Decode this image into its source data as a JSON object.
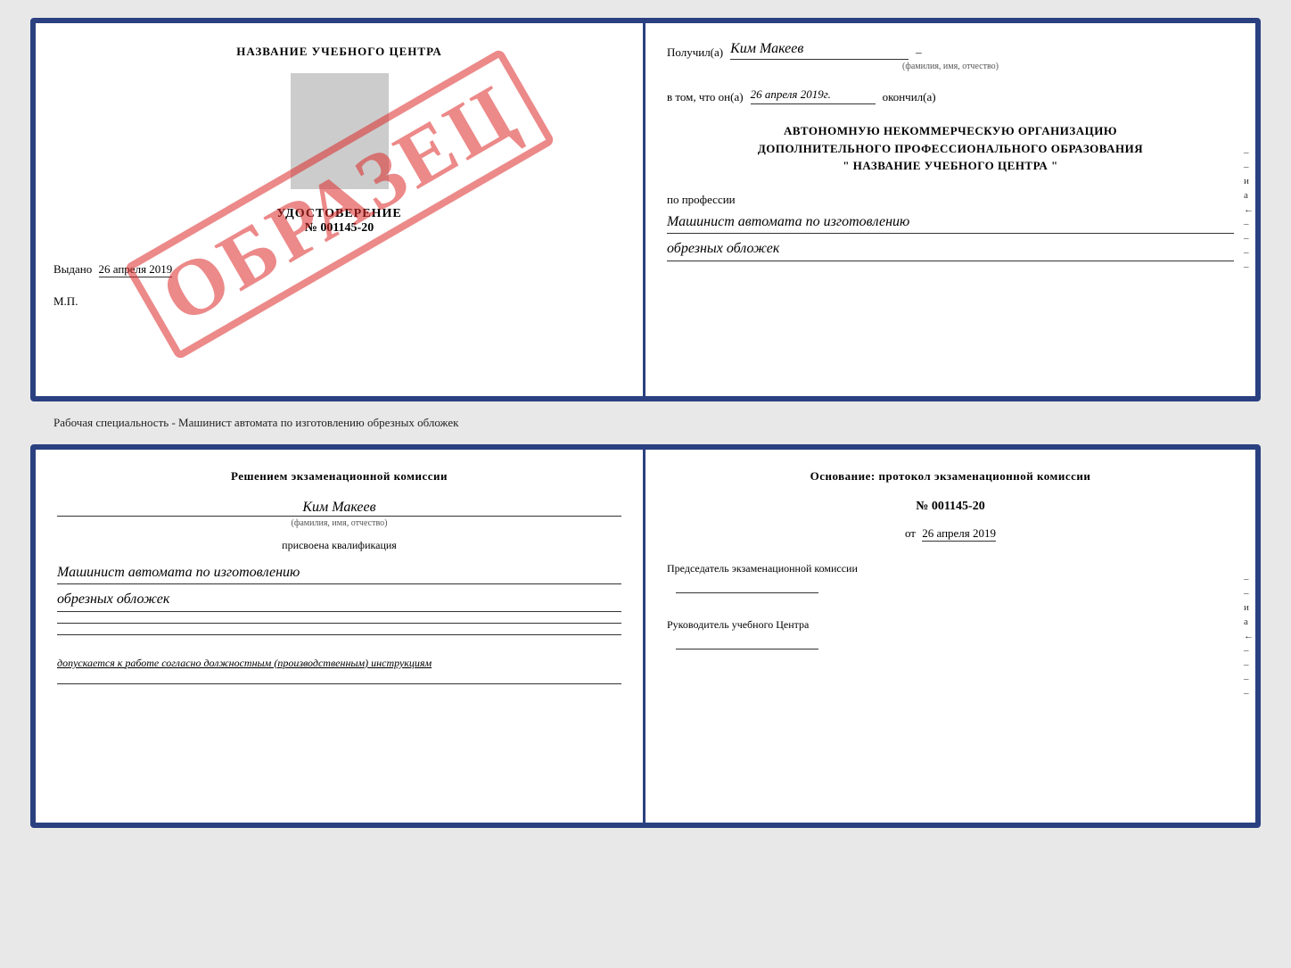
{
  "doc1": {
    "left": {
      "title": "НАЗВАНИЕ УЧЕБНОГО ЦЕНТРА",
      "watermark": "ОБРАЗЕЦ",
      "cert_label": "УДОСТОВЕРЕНИЕ",
      "cert_number": "№ 001145-20",
      "vydano_label": "Выдано",
      "vydano_date": "26 апреля 2019",
      "mp_label": "М.П."
    },
    "right": {
      "poluchil_label": "Получил(а)",
      "poluchil_name": "Ким Макеев",
      "fio_hint": "(фамилия, имя, отчество)",
      "vtom_label": "в том, что он(а)",
      "vtom_date": "26 апреля 2019г.",
      "okonchil_label": "окончил(а)",
      "org_line1": "АВТОНОМНУЮ НЕКОММЕРЧЕСКУЮ ОРГАНИЗАЦИЮ",
      "org_line2": "ДОПОЛНИТЕЛЬНОГО ПРОФЕССИОНАЛЬНОГО ОБРАЗОВАНИЯ",
      "org_line3": "\"  НАЗВАНИЕ УЧЕБНОГО ЦЕНТРА  \"",
      "po_professii_label": "по профессии",
      "professiya_line1": "Машинист автомата по изготовлению",
      "professiya_line2": "обрезных обложек"
    }
  },
  "specialty_label": "Рабочая специальность - Машинист автомата по изготовлению обрезных обложек",
  "doc2": {
    "left": {
      "resheniem_label": "Решением экзаменационной комиссии",
      "fio_value": "Ким Макеев",
      "fio_hint": "(фамилия, имя, отчество)",
      "prisvoena_label": "присвоена квалификация",
      "kvalif_line1": "Машинист автомата по изготовлению",
      "kvalif_line2": "обрезных обложек",
      "dopuskaetsya_label": "допускается к",
      "dopuskaetsya_value": "работе согласно должностным (производственным) инструкциям"
    },
    "right": {
      "osnovanie_label": "Основание: протокол экзаменационной комиссии",
      "nomer_label": "№ 001145-20",
      "ot_label": "от",
      "ot_date": "26 апреля 2019",
      "predsedatel_label": "Председатель экзаменационной комиссии",
      "rukovoditel_label": "Руководитель учебного Центра"
    }
  }
}
